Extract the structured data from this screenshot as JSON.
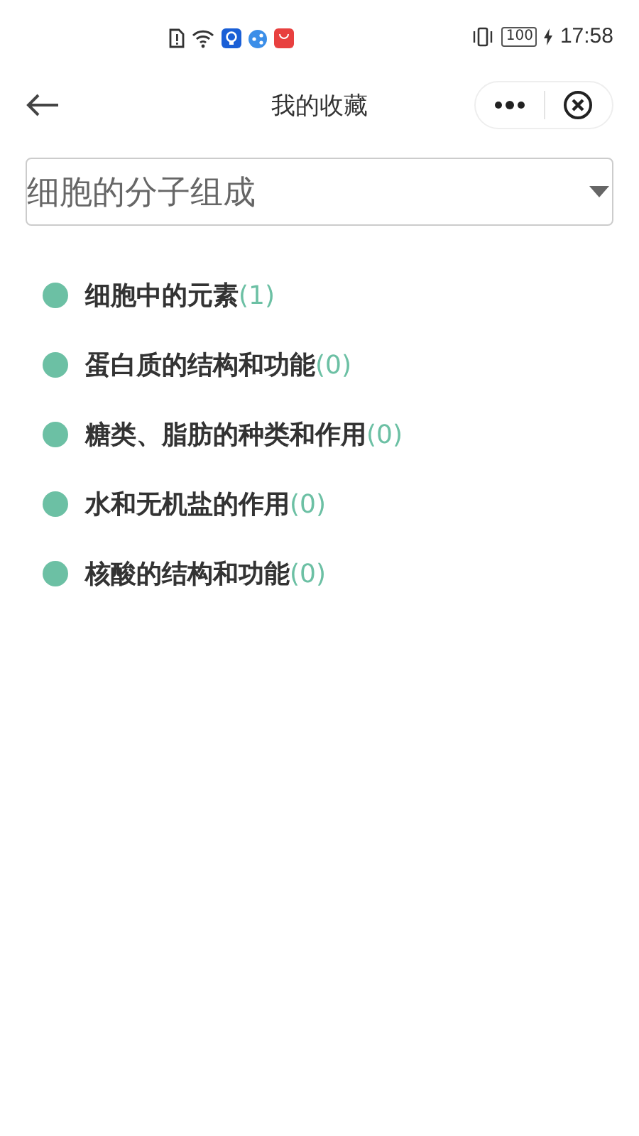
{
  "status_bar": {
    "battery": "100",
    "time": "17:58"
  },
  "header": {
    "title": "我的收藏"
  },
  "dropdown": {
    "value": "细胞的分子组成"
  },
  "items": [
    {
      "label": "细胞中的元素",
      "count": "(1)"
    },
    {
      "label": "蛋白质的结构和功能",
      "count": "(0)"
    },
    {
      "label": "糖类、脂肪的种类和作用",
      "count": "(0)"
    },
    {
      "label": "水和无机盐的作用",
      "count": "(0)"
    },
    {
      "label": "核酸的结构和功能",
      "count": "(0)"
    }
  ]
}
